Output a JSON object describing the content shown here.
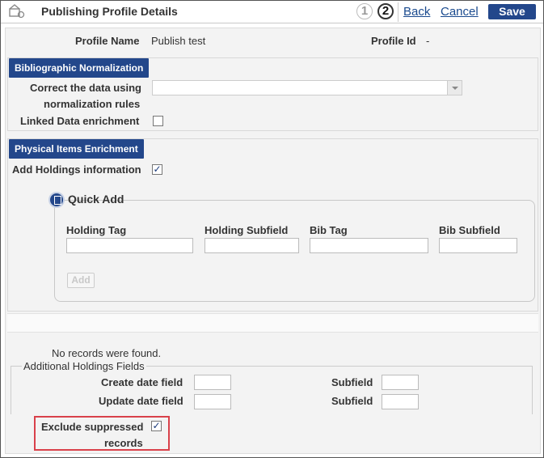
{
  "header": {
    "title": "Publishing Profile Details",
    "steps": [
      "1",
      "2"
    ],
    "back_label": "Back",
    "cancel_label": "Cancel",
    "save_label": "Save"
  },
  "profile": {
    "name_label": "Profile Name",
    "name_value": "Publish test",
    "id_label": "Profile Id",
    "id_value": "-"
  },
  "bib_normalization": {
    "tab_label": "Bibliographic Normalization",
    "correct_label_line1": "Correct the data using",
    "correct_label_line2": "normalization rules",
    "correct_value": "",
    "linked_data_label": "Linked Data enrichment",
    "linked_data_checked": false
  },
  "physical_items": {
    "tab_label": "Physical Items Enrichment",
    "add_holdings_label": "Add Holdings information",
    "add_holdings_checked": true,
    "quick_add": {
      "title": "Quick Add",
      "columns": [
        "Holding Tag",
        "Holding Subfield",
        "Bib Tag",
        "Bib Subfield"
      ],
      "add_label": "Add"
    },
    "no_records": "No records were found.",
    "additional": {
      "legend": "Additional Holdings Fields",
      "create_date_label": "Create date field",
      "update_date_label": "Update date field",
      "subfield_label": "Subfield"
    },
    "exclude_suppressed_line1": "Exclude suppressed",
    "exclude_suppressed_line2": "records",
    "exclude_suppressed_checked": true
  },
  "colors": {
    "brand": "#23478b",
    "highlight": "#d9414a",
    "link": "#1a4a8e"
  }
}
